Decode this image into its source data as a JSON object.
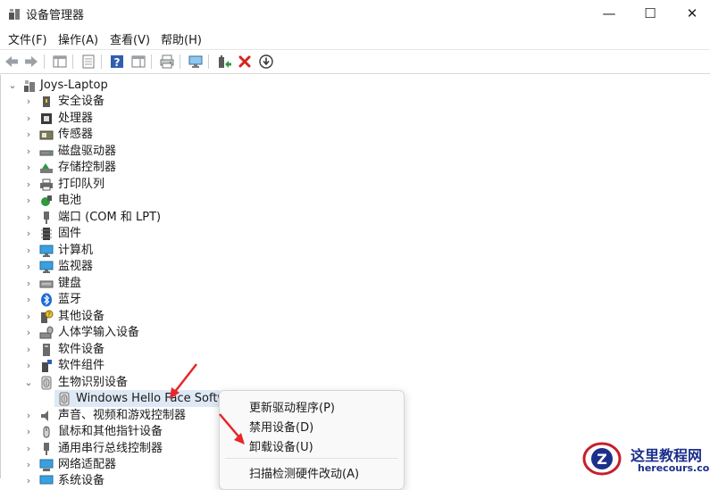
{
  "window": {
    "title": "设备管理器"
  },
  "controls": {
    "minimize": "—",
    "maximize": "☐",
    "close": "✕"
  },
  "menu": [
    "文件(F)",
    "操作(A)",
    "查看(V)",
    "帮助(H)"
  ],
  "tree": {
    "root": "Joys-Laptop",
    "categories": [
      "安全设备",
      "处理器",
      "传感器",
      "磁盘驱动器",
      "存储控制器",
      "打印队列",
      "电池",
      "端口 (COM 和 LPT)",
      "固件",
      "计算机",
      "监视器",
      "键盘",
      "蓝牙",
      "其他设备",
      "人体学输入设备",
      "软件设备",
      "软件组件",
      "生物识别设备"
    ],
    "biometric_child": "Windows Hello Face Softwar",
    "after": [
      "声音、视频和游戏控制器",
      "鼠标和其他指针设备",
      "通用串行总线控制器",
      "网络适配器",
      "系统设备"
    ]
  },
  "context_menu": {
    "update_driver": "更新驱动程序(P)",
    "disable": "禁用设备(D)",
    "uninstall": "卸载设备(U)",
    "scan": "扫描检测硬件改动(A)"
  },
  "watermark": {
    "title": "这里教程网",
    "site": "herecours.com"
  }
}
